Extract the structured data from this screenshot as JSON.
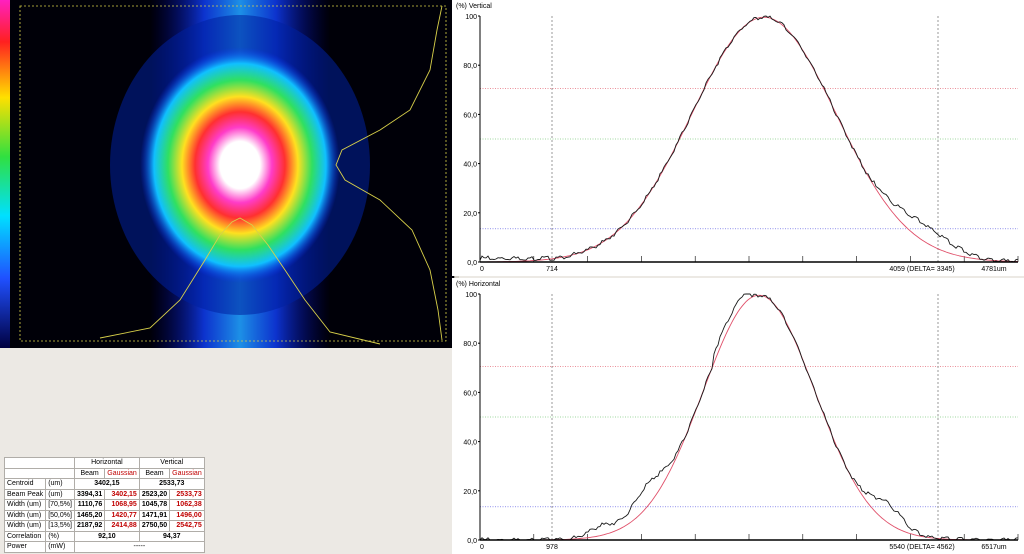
{
  "colors": {
    "beam_curve": "#1a1a1a",
    "fit_curve": "#e0506a",
    "grid_red": "#e05060",
    "grid_green": "#40b040",
    "grid_blue": "#5050e0",
    "profile_yellow": "#d8d04a"
  },
  "vertical": {
    "title": "(%) Vertical",
    "y_ticks": [
      "100",
      "80,0",
      "60,0",
      "40,0",
      "20,0",
      "0,0"
    ],
    "x_labels": [
      "0",
      "714",
      "4059 (DELTA= 3345)",
      "4781um"
    ]
  },
  "horizontal": {
    "title": "(%) Horizontal",
    "y_ticks": [
      "100",
      "80,0",
      "60,0",
      "40,0",
      "20,0",
      "0,0"
    ],
    "x_labels": [
      "0",
      "978",
      "5540 (DELTA= 4562)",
      "6517um"
    ]
  },
  "table": {
    "groups": [
      "Horizontal",
      "Vertical"
    ],
    "subheads": [
      "Beam",
      "Gaussian",
      "Beam",
      "Gaussian"
    ],
    "rows": [
      {
        "label": "Centroid",
        "unit": "(um)",
        "h": "3402,15",
        "v": "2533,73"
      },
      {
        "label": "Beam Peak",
        "unit": "(um)",
        "cells": [
          "3394,31",
          "3402,15",
          "2523,20",
          "2533,73"
        ]
      },
      {
        "label": "Width (um)",
        "unit": "[70,5%]",
        "cells": [
          "1110,76",
          "1068,95",
          "1045,78",
          "1062,38"
        ]
      },
      {
        "label": "Width (um)",
        "unit": "[50,0%]",
        "cells": [
          "1465,20",
          "1420,77",
          "1471,91",
          "1496,00"
        ]
      },
      {
        "label": "Width (um)",
        "unit": "[13,5%]",
        "cells": [
          "2187,92",
          "2414,88",
          "2750,50",
          "2542,75"
        ]
      },
      {
        "label": "Correlation",
        "unit": "(%)",
        "h": "92,10",
        "v": "94,37"
      },
      {
        "label": "Power",
        "unit": "(mW)",
        "h": "-----"
      }
    ]
  }
}
